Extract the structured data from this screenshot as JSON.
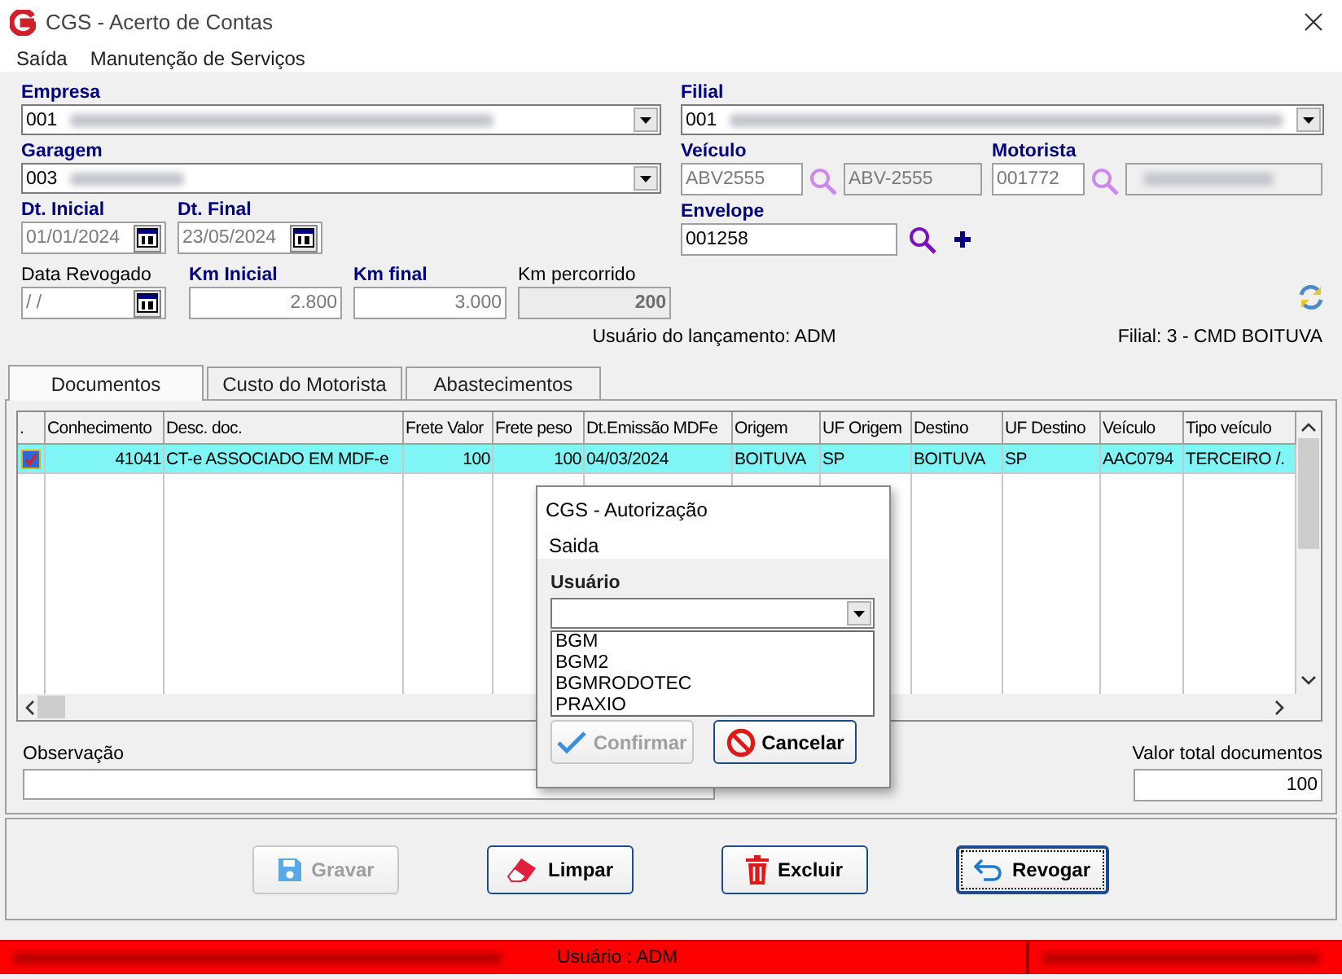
{
  "window": {
    "title": "CGS - Acerto de Contas"
  },
  "menu": [
    {
      "label": "Saída"
    },
    {
      "label": "Manutenção de Serviços"
    }
  ],
  "form": {
    "empresa": {
      "label": "Empresa",
      "required": true,
      "code": "001"
    },
    "garagem": {
      "label": "Garagem",
      "required": true,
      "code": "003"
    },
    "dt_inicial": {
      "label": "Dt. Inicial",
      "required": true,
      "value": "01/01/2024",
      "disabled": true
    },
    "dt_final": {
      "label": "Dt. Final",
      "required": true,
      "value": "23/05/2024",
      "disabled": true
    },
    "data_revogado": {
      "label": "Data Revogado",
      "required": false,
      "value": "/ /",
      "disabled": true
    },
    "km_inicial": {
      "label": "Km Inicial",
      "required": true,
      "value": "2.800",
      "disabled": true
    },
    "km_final": {
      "label": "Km final",
      "required": true,
      "value": "3.000",
      "disabled": true
    },
    "km_percorrido": {
      "label": "Km percorrido",
      "required": false,
      "value": "200"
    },
    "filial": {
      "label": "Filial",
      "required": true,
      "code": "001"
    },
    "veiculo": {
      "label": "Veículo",
      "required": true,
      "code": "ABV2555",
      "plate": "ABV-2555",
      "disabled": true
    },
    "motorista": {
      "label": "Motorista",
      "required": true,
      "code": "001772",
      "disabled": true
    },
    "envelope": {
      "label": "Envelope",
      "required": true,
      "value": "001258",
      "disabled": false
    }
  },
  "info": {
    "user": "Usuário do lançamento: ADM",
    "filial": "Filial: 3 - CMD BOITUVA"
  },
  "tabs": [
    {
      "label": "Documentos",
      "selected": true
    },
    {
      "label": "Custo do Motorista",
      "selected": false
    },
    {
      "label": "Abastecimentos",
      "selected": false
    }
  ],
  "table": {
    "select_header": ".",
    "columns": [
      "Conhecimento",
      "Desc. doc.",
      "Frete Valor",
      "Frete peso",
      "Dt.Emissão MDFe",
      "Origem",
      "UF Origem",
      "Destino",
      "UF Destino",
      "Veículo",
      "Tipo veículo"
    ],
    "rows": [
      {
        "selected": true,
        "checked": true,
        "cells": [
          "41041",
          "CT-e ASSOCIADO EM MDF-e",
          "100",
          "100",
          "04/03/2024",
          "BOITUVA",
          "SP",
          "BOITUVA",
          "SP",
          "AAC0794",
          "TERCEIRO /."
        ]
      }
    ]
  },
  "observacao": {
    "label": "Observação"
  },
  "total": {
    "label": "Valor total documentos",
    "value": "100"
  },
  "buttons": [
    {
      "label": "Gravar",
      "kind": "save",
      "disabled": true,
      "focused": false
    },
    {
      "label": "Limpar",
      "kind": "clear",
      "disabled": false,
      "focused": false
    },
    {
      "label": "Excluir",
      "kind": "delete",
      "disabled": false,
      "focused": false
    },
    {
      "label": "Revogar",
      "kind": "revoke",
      "disabled": false,
      "focused": true
    }
  ],
  "status_bar": {
    "user": "Usuário : ADM"
  },
  "dialog": {
    "title": "CGS - Autorização",
    "menu": "Saida",
    "field_label": "Usuário",
    "options": [
      "BGM",
      "BGM2",
      "BGMRODOTEC",
      "PRAXIO"
    ],
    "buttons": [
      {
        "label": "Confirmar",
        "kind": "confirm",
        "disabled": true
      },
      {
        "label": "Cancelar",
        "kind": "cancel",
        "disabled": false
      }
    ]
  }
}
